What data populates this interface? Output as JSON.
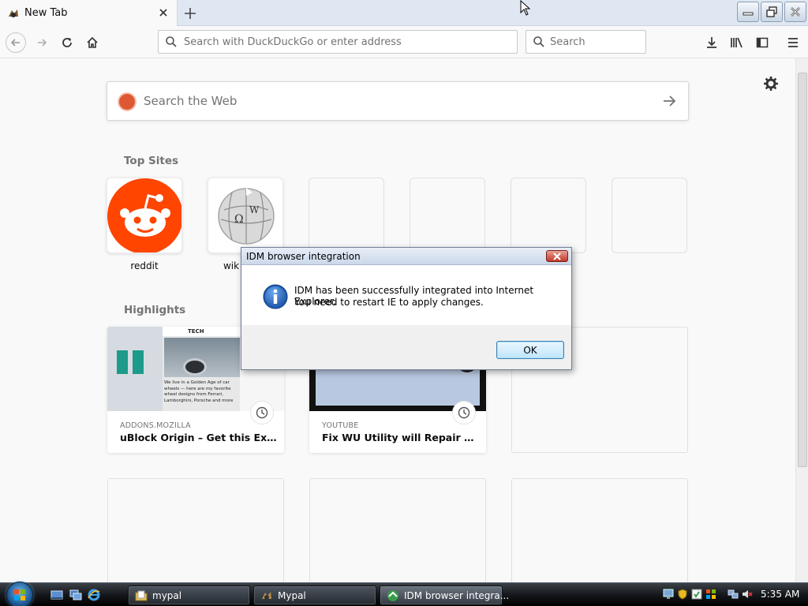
{
  "browser": {
    "tab": {
      "title": "New Tab"
    },
    "urlbar": {
      "placeholder": "Search with DuckDuckGo or enter address"
    },
    "searchbar": {
      "placeholder": "Search"
    }
  },
  "newtab": {
    "search_placeholder": "Search the Web",
    "top_sites_title": "Top Sites",
    "top_sites": [
      {
        "label": "reddit",
        "icon": "reddit-icon"
      },
      {
        "label": "wik",
        "icon": "wikipedia-icon"
      }
    ],
    "highlights_title": "Highlights",
    "highlights": [
      {
        "host": "ADDONS.MOZILLA",
        "title": "uBlock Origin – Get this Extensio...",
        "thumb_heading": "TECH",
        "thumb_text": "We live in a Golden Age of car wheels — here are my favorite wheel designs from Ferrari, Lamborghini, Porsche and more"
      },
      {
        "host": "YOUTUBE",
        "title": "Fix WU Utility will Repair & Fix ..."
      }
    ]
  },
  "dialog": {
    "title": "IDM browser integration",
    "line1": "IDM has been successfully integrated into Internet Explorer.",
    "line2": "You need to restart IE to apply changes.",
    "ok_label": "OK"
  },
  "taskbar": {
    "tasks": [
      {
        "label": "mypal",
        "icon": "folder-icon"
      },
      {
        "label": "Mypal",
        "icon": "mypal-icon"
      },
      {
        "label": "IDM browser integra...",
        "icon": "idm-icon"
      }
    ],
    "clock": "5:35 AM"
  },
  "colors": {
    "reddit": "#ff4500",
    "duckduckgo": "#de5833",
    "ok_border": "#3c7fb1"
  }
}
